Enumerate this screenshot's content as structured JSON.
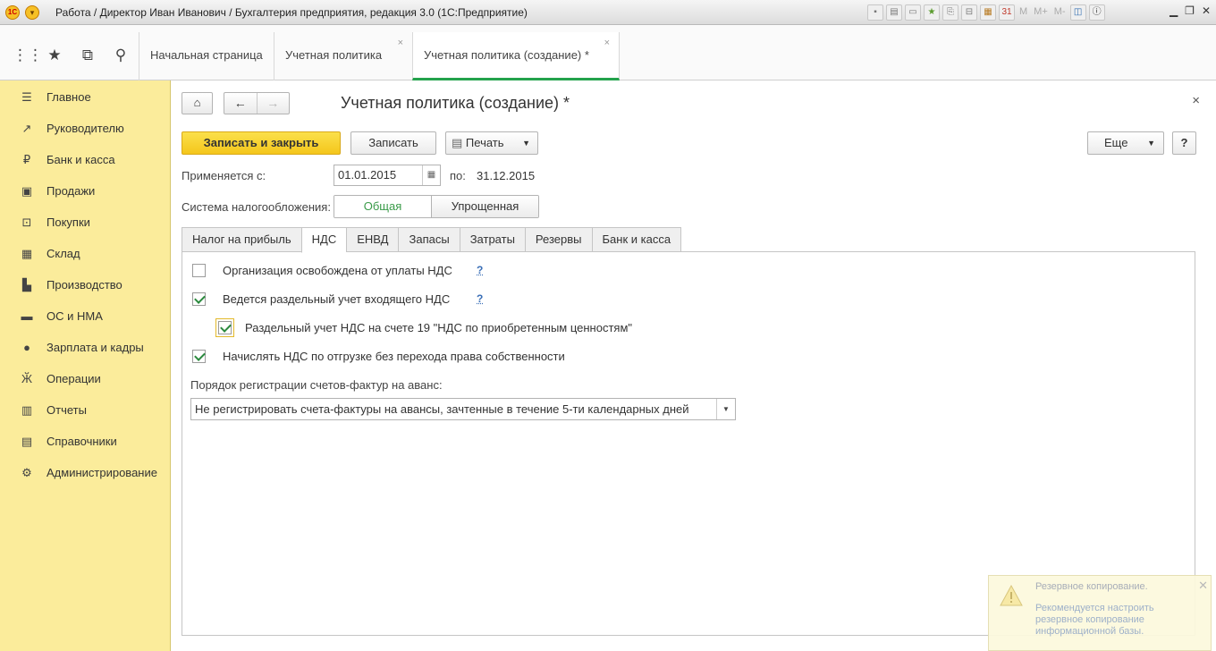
{
  "window": {
    "title": "Работа / Директор Иван Иванович / Бухгалтерия предприятия, редакция 3.0  (1С:Предприятие)",
    "logo_text": "1С",
    "toolbar_text_buttons": [
      "M",
      "M+",
      "M-"
    ]
  },
  "tabs": [
    {
      "label": "Начальная страница",
      "closable": false,
      "active": false
    },
    {
      "label": "Учетная политика",
      "closable": true,
      "active": false
    },
    {
      "label": "Учетная политика (создание) *",
      "closable": true,
      "active": true
    }
  ],
  "sidebar": {
    "items": [
      {
        "label": "Главное",
        "icon": "menu-icon"
      },
      {
        "label": "Руководителю",
        "icon": "trend-icon"
      },
      {
        "label": "Банк и касса",
        "icon": "ruble-icon"
      },
      {
        "label": "Продажи",
        "icon": "bag-icon"
      },
      {
        "label": "Покупки",
        "icon": "cart-icon"
      },
      {
        "label": "Склад",
        "icon": "warehouse-icon"
      },
      {
        "label": "Производство",
        "icon": "factory-icon"
      },
      {
        "label": "ОС и НМА",
        "icon": "truck-icon"
      },
      {
        "label": "Зарплата и кадры",
        "icon": "person-icon"
      },
      {
        "label": "Операции",
        "icon": "operations-icon"
      },
      {
        "label": "Отчеты",
        "icon": "chart-icon"
      },
      {
        "label": "Справочники",
        "icon": "book-icon"
      },
      {
        "label": "Администрирование",
        "icon": "gear-icon"
      }
    ]
  },
  "form": {
    "title": "Учетная политика (создание) *",
    "buttons": {
      "save_close": "Записать и закрыть",
      "save": "Записать",
      "print": "Печать",
      "more": "Еще",
      "help": "?"
    },
    "applies_from_label": "Применяется с:",
    "applies_from_value": "01.01.2015",
    "to_label": "по:",
    "to_value": "31.12.2015",
    "tax_system_label": "Система налогообложения:",
    "tax_options": [
      "Общая",
      "Упрощенная"
    ],
    "tax_selected": "Общая",
    "form_tabs": [
      "Налог на прибыль",
      "НДС",
      "ЕНВД",
      "Запасы",
      "Затраты",
      "Резервы",
      "Банк и касса"
    ],
    "active_tab": "НДС",
    "vat": {
      "cb1": {
        "label": "Организация освобождена от уплаты НДС",
        "checked": false,
        "help": "?"
      },
      "cb2": {
        "label": "Ведется раздельный учет входящего НДС",
        "checked": true,
        "help": "?"
      },
      "cb3": {
        "label": "Раздельный учет НДС на счете 19 \"НДС по приобретенным ценностям\"",
        "checked": true
      },
      "cb4": {
        "label": "Начислять НДС по отгрузке без перехода права собственности",
        "checked": true
      },
      "invoice_order_label": "Порядок регистрации счетов-фактур на аванс:",
      "invoice_order_value": "Не регистрировать счета-фактуры на авансы, зачтенные в течение 5-ти календарных дней"
    }
  },
  "notification": {
    "title": "Резервное копирование.",
    "body": "Рекомендуется настроить резервное копирование информационной базы."
  },
  "colors": {
    "sidebar_bg": "#fbec9b",
    "primary_button": "#f4c61c",
    "active_tab_underline": "#24a24c",
    "active_option": "#3a9b49"
  }
}
